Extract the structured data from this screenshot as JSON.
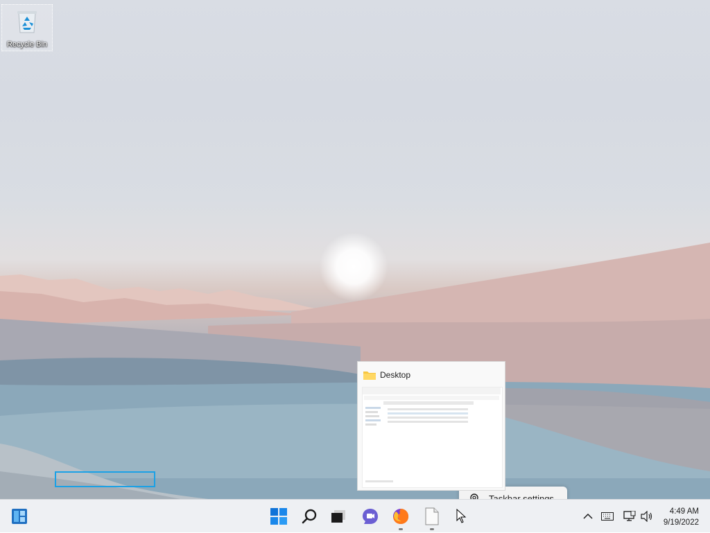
{
  "desktop": {
    "recycle_bin_label": "Recycle Bin"
  },
  "preview": {
    "title": "Desktop"
  },
  "context_menu": {
    "taskbar_settings": "Taskbar settings"
  },
  "taskbar": {
    "apps": [
      "start",
      "search",
      "task-view",
      "chat",
      "firefox",
      "file-explorer",
      "cursor"
    ],
    "tray": {
      "time": "4:49 AM",
      "date": "9/19/2022"
    }
  }
}
